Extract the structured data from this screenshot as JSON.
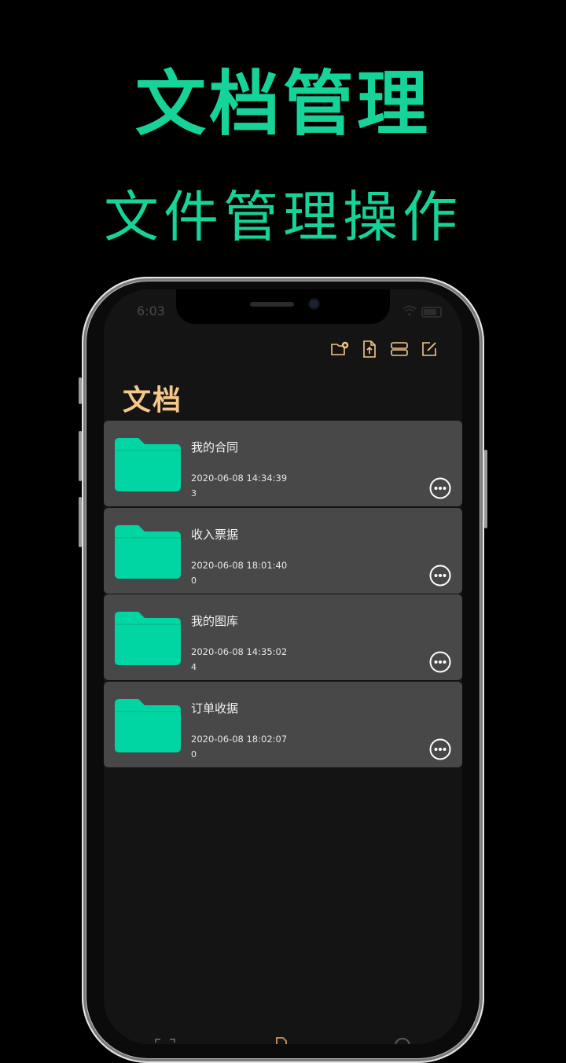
{
  "hero": {
    "title": "文档管理",
    "subtitle": "文件管理操作"
  },
  "status": {
    "time": "6:03"
  },
  "screen": {
    "title": "文档",
    "toolbar": [
      "new-folder-icon",
      "import-file-icon",
      "layout-icon",
      "edit-icon"
    ],
    "items": [
      {
        "name": "我的合同",
        "date": "2020-06-08 14:34:39",
        "count": "3"
      },
      {
        "name": "收入票据",
        "date": "2020-06-08 18:01:40",
        "count": "0"
      },
      {
        "name": "我的图库",
        "date": "2020-06-08 14:35:02",
        "count": "4"
      },
      {
        "name": "订单收据",
        "date": "2020-06-08 18:02:07",
        "count": "0"
      }
    ]
  },
  "colors": {
    "brand": "#16d39a",
    "accent": "#f5c789",
    "folder": "#00d6a3",
    "row": "#484849"
  }
}
